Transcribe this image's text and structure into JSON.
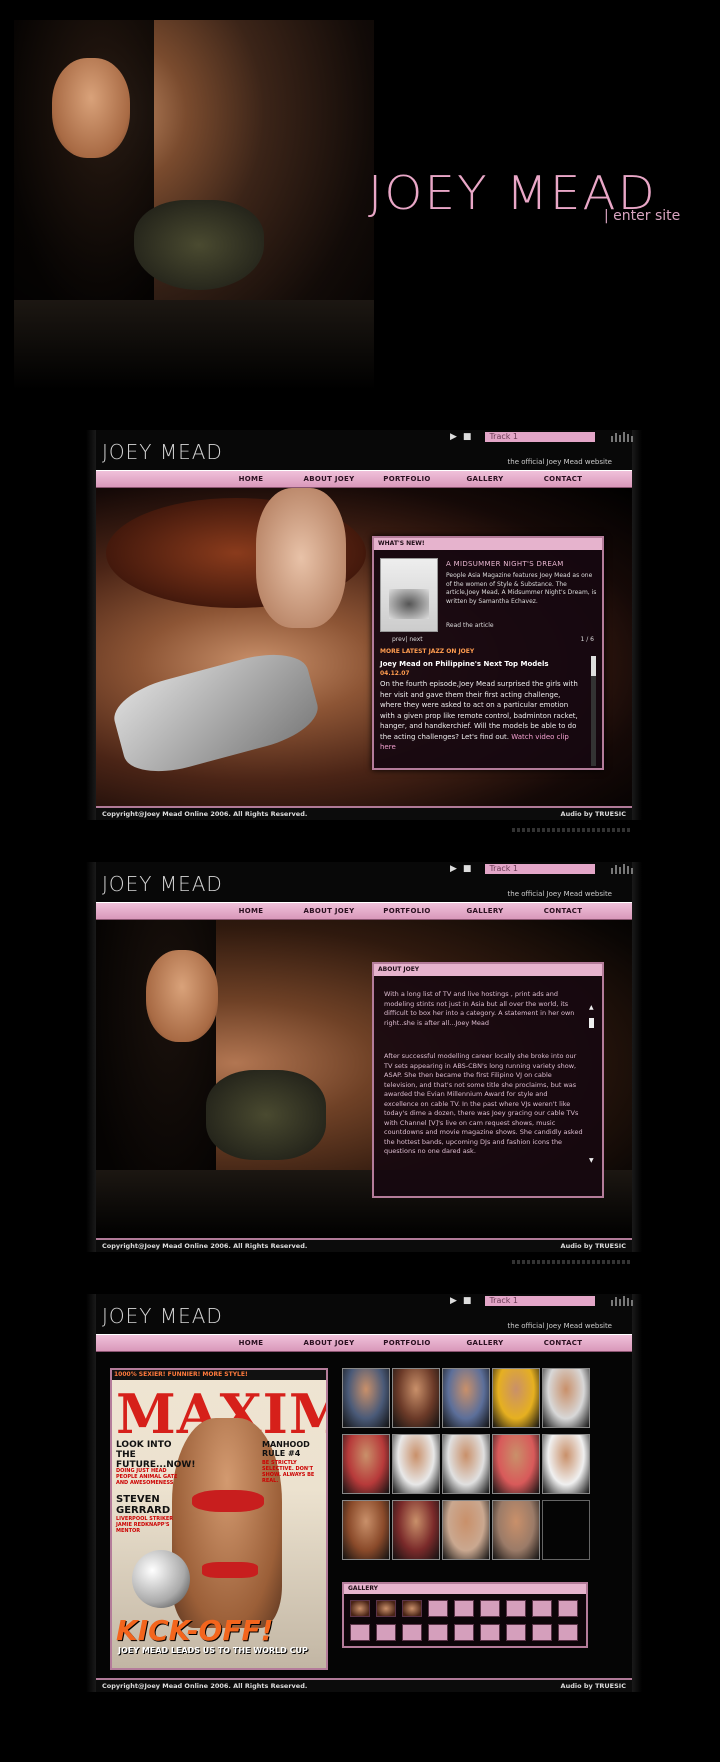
{
  "splash": {
    "title": "JOEY MEAD",
    "enter": "| enter site"
  },
  "site": {
    "logo": "JOEY MEAD",
    "official": "the official Joey Mead website",
    "player": {
      "play_icon": "play-icon",
      "stop_icon": "stop-icon",
      "track": "Track 1"
    },
    "nav": [
      "HOME",
      "ABOUT JOEY",
      "PORTFOLIO",
      "GALLERY",
      "CONTACT"
    ],
    "footer_left": "Copyright@Joey Mead Online 2006. All Rights Reserved.",
    "footer_right": "Audio by TRUESIC"
  },
  "whats_new": {
    "heading": "WHAT'S NEW!",
    "title": "A MIDSUMMER NIGHT'S DREAM",
    "text": "People Asia Magazine features Joey Mead as one of the women of Style & Substance. The article,Joey Mead, A Midsummer Night's Dream, is written by Samantha Echavez.",
    "read": "Read the article",
    "pager": "prev| next",
    "count": "1 / 6",
    "more": "MORE LATEST JAZZ ON JOEY",
    "item_title": "Joey Mead on Philippine's Next Top Models",
    "date": "04.12.07",
    "body": "On the fourth episode,Joey Mead surprised the girls with her visit and gave them their first acting challenge, where they were asked to act on a particular emotion with a given prop like remote control, badminton racket, hanger, and handkerchief. Will the models be able to do the acting challenges? Let's find out.",
    "link": "Watch video clip here"
  },
  "about": {
    "heading": "ABOUT JOEY",
    "p1": "With a long list of TV and live hostings , print ads and modeling stints not just in Asia but all over the world, its difficult to box her into a category. A statement in her own right..she is after all...Joey Mead",
    "p2": "After successful modelling career locally she broke into our TV sets appearing in ABS-CBN's long running variety show, ASAP. She then became the first Filipino VJ on cable television, and that's not some title she proclaims, but was awarded the Evian Millennium Award for style and excellence on cable TV. In the past where VJs weren't like today's dime a dozen, there was Joey gracing our cable TVs with Channel [V]'s live on cam request shows, music countdowns and movie magazine shows. She candidly asked the hottest bands, upcoming DJs and fashion icons the questions no one dared ask."
  },
  "magazine": {
    "strip": "1000% SEXIER! FUNNIER! MORE STYLE!",
    "title": "MAXIM",
    "left1": "LOOK INTO THE FUTURE...NOW!",
    "left2": "DOING JUST HEAD PEOPLE ANIMAL GATE AND AWESOMENESS",
    "left3": "STEVEN GERRARD",
    "left4": "LIVERPOOL STRIKER JAMIE REDKNAPP'S MENTOR",
    "right1": "MANHOOD RULE #4",
    "right2": "BE STRICTLY SELECTIVE. DON'T SHOW. ALWAYS BE REAL.",
    "kick": "KICK-OFF!",
    "sub": "JOEY MEAD LEADS US TO THE WORLD CUP"
  },
  "gallery": {
    "heading": "GALLERY",
    "thumb_colors": [
      "#4a5a78",
      "#6b3a28",
      "#5c6f9a",
      "#e6b020",
      "#d8d8d8",
      "#b73a3a",
      "#e8e8e8",
      "#e0e0e0",
      "#d85a5a",
      "#f0f0f0",
      "#8a4a2a",
      "#7a2a2a",
      "#caa890",
      "#9b7b68",
      "#000000"
    ]
  }
}
